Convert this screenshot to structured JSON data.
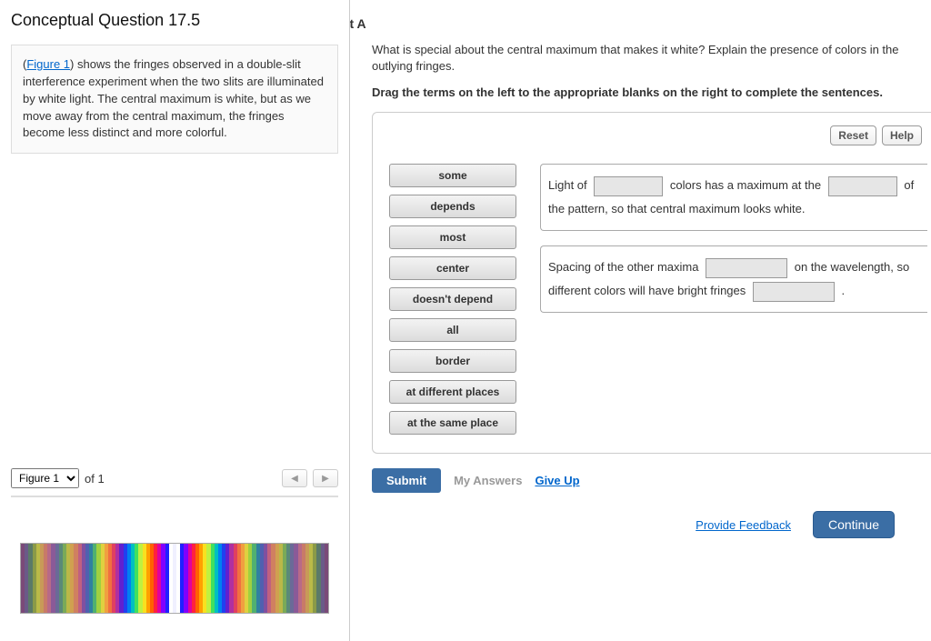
{
  "left": {
    "title": "Conceptual Question 17.5",
    "figure_link": "Figure 1",
    "desc_before": "(",
    "desc_after": ") shows the fringes observed in a double-slit interference experiment when the two slits are illuminated by white light. The central maximum is white, but as we move away from the central maximum, the fringes become less distinct and more colorful.",
    "fig_selected": "Figure 1",
    "fig_total": "of 1"
  },
  "right": {
    "part_label": "rt A",
    "prompt": "What is special about the central maximum that makes it white? Explain the presence of colors in the outlying fringes.",
    "instruction": "Drag the terms on the left to the appropriate blanks on the right to complete the sentences.",
    "reset": "Reset",
    "help": "Help",
    "terms": [
      "some",
      "depends",
      "most",
      "center",
      "doesn't depend",
      "all",
      "border",
      "at different places",
      "at the same place"
    ],
    "sentence1_a": "Light of",
    "sentence1_b": "colors has a maximum at the",
    "sentence1_c": "of the pattern, so that central maximum looks white.",
    "sentence2_a": "Spacing of the other maxima",
    "sentence2_b": "on the wavelength, so different colors will have bright fringes",
    "sentence2_c": ".",
    "submit": "Submit",
    "my_answers": "My Answers",
    "give_up": "Give Up",
    "feedback": "Provide Feedback",
    "continue": "Continue"
  },
  "fringe_colors": [
    "#7a4a78",
    "#6a5a88",
    "#5a7a68",
    "#8a9a48",
    "#baba48",
    "#c89a58",
    "#c87a68",
    "#b86a88",
    "#8a5a98",
    "#6a6a98",
    "#5a8a78",
    "#7aaa58",
    "#bab848",
    "#d0a050",
    "#d08060",
    "#c06080",
    "#8050a0",
    "#5060b0",
    "#3080a0",
    "#50b070",
    "#a0d040",
    "#e0d040",
    "#f0a040",
    "#f07040",
    "#e04060",
    "#b030a0",
    "#6020d0",
    "#2040f0",
    "#0080f0",
    "#00c0c0",
    "#40e060",
    "#c0f040",
    "#f8e020",
    "#ffa000",
    "#ff6000",
    "#ff2040",
    "#e000a0",
    "#8000ff",
    "#2020ff",
    "#ffffff",
    "#f0f0ff",
    "#ffffff",
    "#2020ff",
    "#8000ff",
    "#e000a0",
    "#ff2040",
    "#ff6000",
    "#ffa000",
    "#f8e020",
    "#c0f040",
    "#40e060",
    "#00c0c0",
    "#0080f0",
    "#2040f0",
    "#6020d0",
    "#b030a0",
    "#e04060",
    "#f07040",
    "#f0a040",
    "#e0d040",
    "#a0d040",
    "#50b070",
    "#3080a0",
    "#5060b0",
    "#8050a0",
    "#c06080",
    "#d08060",
    "#d0a050",
    "#bab848",
    "#7aaa58",
    "#5a8a78",
    "#6a6a98",
    "#8a5a98",
    "#b86a88",
    "#c87a68",
    "#c89a58",
    "#baba48",
    "#8a9a48",
    "#5a7a68",
    "#6a5a88",
    "#7a4a78"
  ]
}
